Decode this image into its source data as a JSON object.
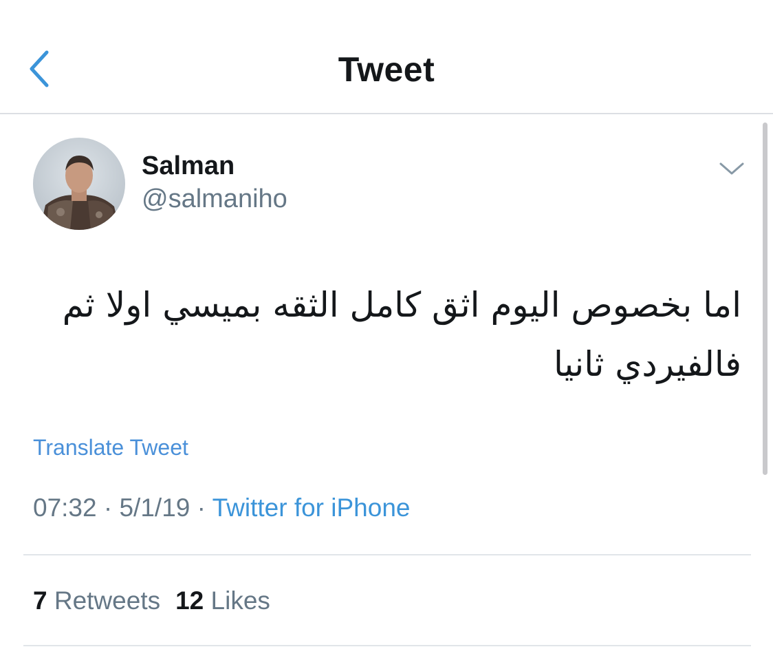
{
  "header": {
    "title": "Tweet",
    "back_icon": "chevron-left-icon"
  },
  "colors": {
    "accent": "#3b94d9",
    "text_primary": "#14171a",
    "text_secondary": "#657786",
    "divider": "#e1e5e9"
  },
  "author": {
    "name": "Salman",
    "handle": "@salmaniho",
    "avatar_icon": "avatar"
  },
  "tweet": {
    "text": "اما بخصوص اليوم اثق كامل الثقه بميسي اولا ثم فالفيردي ثانيا",
    "translate_label": "Translate Tweet"
  },
  "meta": {
    "time": "07:32",
    "separator": " · ",
    "date": "5/1/19",
    "source": "Twitter for iPhone"
  },
  "stats": {
    "retweets_count": "7",
    "retweets_label": "Retweets",
    "likes_count": "12",
    "likes_label": "Likes"
  }
}
